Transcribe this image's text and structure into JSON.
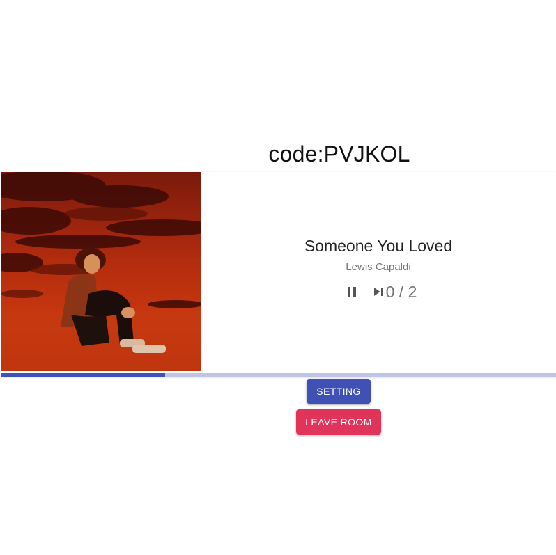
{
  "room": {
    "code_label": "code:PVJKOL"
  },
  "song": {
    "title": "Someone You Loved",
    "artist": "Lewis Capaldi",
    "votes": "0 / 2",
    "progress": 0.295
  },
  "controls": {
    "pause_icon": "pause-icon",
    "skip_icon": "skip-next-icon"
  },
  "buttons": {
    "setting_label": "SETTING",
    "leave_label": "LEAVE ROOM"
  },
  "colors": {
    "primary": "#3f51b5",
    "secondary": "#e0345a",
    "track": "#bfc4e4"
  }
}
